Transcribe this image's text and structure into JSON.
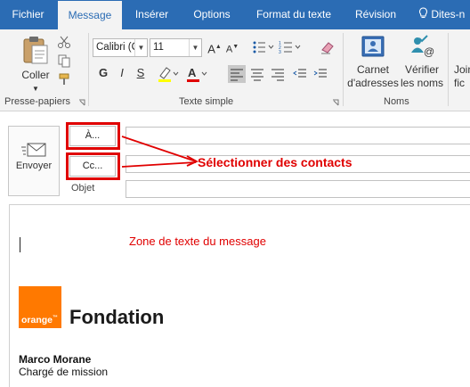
{
  "tabs": [
    {
      "label": "Fichier",
      "active": false
    },
    {
      "label": "Message",
      "active": true
    },
    {
      "label": "Insérer",
      "active": false
    },
    {
      "label": "Options",
      "active": false
    },
    {
      "label": "Format du texte",
      "active": false
    },
    {
      "label": "Révision",
      "active": false
    },
    {
      "label": "Dites-n",
      "active": false
    }
  ],
  "ribbon": {
    "clipboard": {
      "paste_label": "Coller",
      "group_label": "Presse-papiers"
    },
    "basic_text": {
      "font_name": "Calibri (C",
      "font_size": "11",
      "group_label": "Texte simple",
      "bold": "G",
      "italic": "I",
      "underline": "S",
      "grow": "A",
      "shrink": "A"
    },
    "names": {
      "address_book_line1": "Carnet",
      "address_book_line2": "d'adresses",
      "check_names_line1": "Vérifier",
      "check_names_line2": "les noms",
      "group_label": "Noms"
    },
    "partial": {
      "line1": "Join",
      "line2": "fic"
    }
  },
  "compose": {
    "send_label": "Envoyer",
    "to_label": "À...",
    "cc_label": "Cc...",
    "subject_label": "Objet",
    "to_value": "",
    "cc_value": "",
    "subject_value": ""
  },
  "annotations": {
    "select_contacts": "Sélectionner des contacts",
    "body_zone": "Zone de texte du message"
  },
  "signature": {
    "logo_text": "orange",
    "logo_suffix": "™",
    "org_name": "Fondation",
    "person_name": "Marco Morane",
    "person_title": "Chargé de mission"
  },
  "colors": {
    "accent": "#2b6cb4",
    "annotation_red": "#e00000",
    "orange_brand": "#ff7900"
  },
  "icons": [
    "clipboard-icon",
    "scissors-icon",
    "copy-icon",
    "format-painter-icon",
    "bullets-icon",
    "numbering-icon",
    "outdent-icon",
    "indent-icon",
    "eraser-icon",
    "align-left-icon",
    "align-center-icon",
    "align-right-icon",
    "highlighter-icon",
    "font-color-icon",
    "address-book-icon",
    "check-names-icon",
    "lightbulb-icon",
    "send-icon",
    "dialog-launcher-icon"
  ]
}
